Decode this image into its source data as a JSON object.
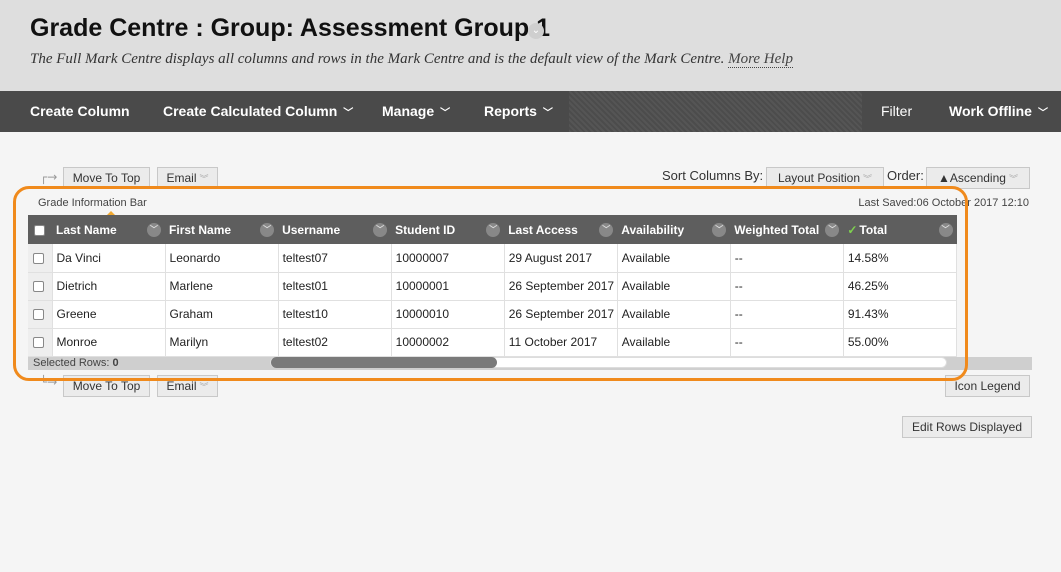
{
  "header": {
    "title": "Grade Centre : Group: Assessment Group 1",
    "subtitle": "The Full Mark Centre displays all columns and rows in the Mark Centre and is the default view of the Mark Centre.",
    "more_help": "More Help"
  },
  "toolbar": {
    "create_column": "Create Column",
    "create_calculated_column": "Create Calculated Column",
    "manage": "Manage",
    "reports": "Reports",
    "filter": "Filter",
    "work_offline": "Work Offline"
  },
  "actions": {
    "move_to_top": "Move To Top",
    "email": "Email",
    "sort_columns_by_label": "Sort Columns By:",
    "sort_columns_by_value": "Layout Position",
    "order_label": "Order:",
    "order_value": "▲Ascending",
    "icon_legend": "Icon Legend",
    "edit_rows_displayed": "Edit Rows Displayed"
  },
  "grid": {
    "info_bar": "Grade Information Bar",
    "last_saved": "Last Saved:06 October 2017 12:10",
    "columns": [
      "Last Name",
      "First Name",
      "Username",
      "Student ID",
      "Last Access",
      "Availability",
      "Weighted Total",
      "Total"
    ],
    "rows": [
      [
        "Da Vinci",
        "Leonardo",
        "teltest07",
        "10000007",
        "29 August 2017",
        "Available",
        "--",
        "14.58%"
      ],
      [
        "Dietrich",
        "Marlene",
        "teltest01",
        "10000001",
        "26 September 2017",
        "Available",
        "--",
        "46.25%"
      ],
      [
        "Greene",
        "Graham",
        "teltest10",
        "10000010",
        "26 September 2017",
        "Available",
        "--",
        "91.43%"
      ],
      [
        "Monroe",
        "Marilyn",
        "teltest02",
        "10000002",
        "11 October 2017",
        "Available",
        "--",
        "55.00%"
      ]
    ],
    "selected_rows_label": "Selected Rows:",
    "selected_rows_count": "0"
  },
  "colors": {
    "highlight": "#f08a1c",
    "toolbar_bg": "#4a4a4a",
    "header_bg": "#dedede",
    "grid_header_bg": "#5e5e5e",
    "total_check": "#7ed14f"
  }
}
